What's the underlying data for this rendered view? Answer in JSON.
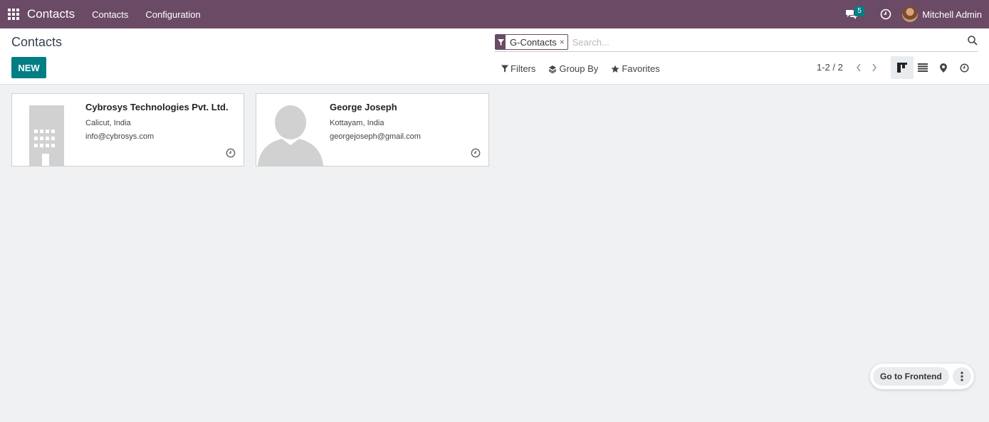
{
  "navbar": {
    "app_name": "Contacts",
    "menus": [
      "Contacts",
      "Configuration"
    ],
    "chat_count": "5",
    "user_name": "Mitchell Admin",
    "bg_color": "#6b4a65"
  },
  "control": {
    "title": "Contacts",
    "new_label": "NEW",
    "facet_value": "G-Contacts",
    "facet_close": "×",
    "search_placeholder": "Search...",
    "filters_label": "Filters",
    "group_by_label": "Group By",
    "favorites_label": "Favorites",
    "pager": "1-2 / 2",
    "views": [
      "kanban-view-icon",
      "list-view-icon",
      "map-view-icon",
      "activity-view-icon"
    ]
  },
  "cards": [
    {
      "name": "Cybrosys Technologies Pvt. Ltd.",
      "location": "Calicut, India",
      "email": "info@cybrosys.com",
      "image": "company-placeholder-icon"
    },
    {
      "name": "George Joseph",
      "location": "Kottayam, India",
      "email": "georgejoseph@gmail.com",
      "image": "person-placeholder-icon"
    }
  ],
  "footer": {
    "goto_frontend": "Go to Frontend"
  },
  "colors": {
    "accent": "#017e84",
    "brand": "#6b4a65"
  }
}
